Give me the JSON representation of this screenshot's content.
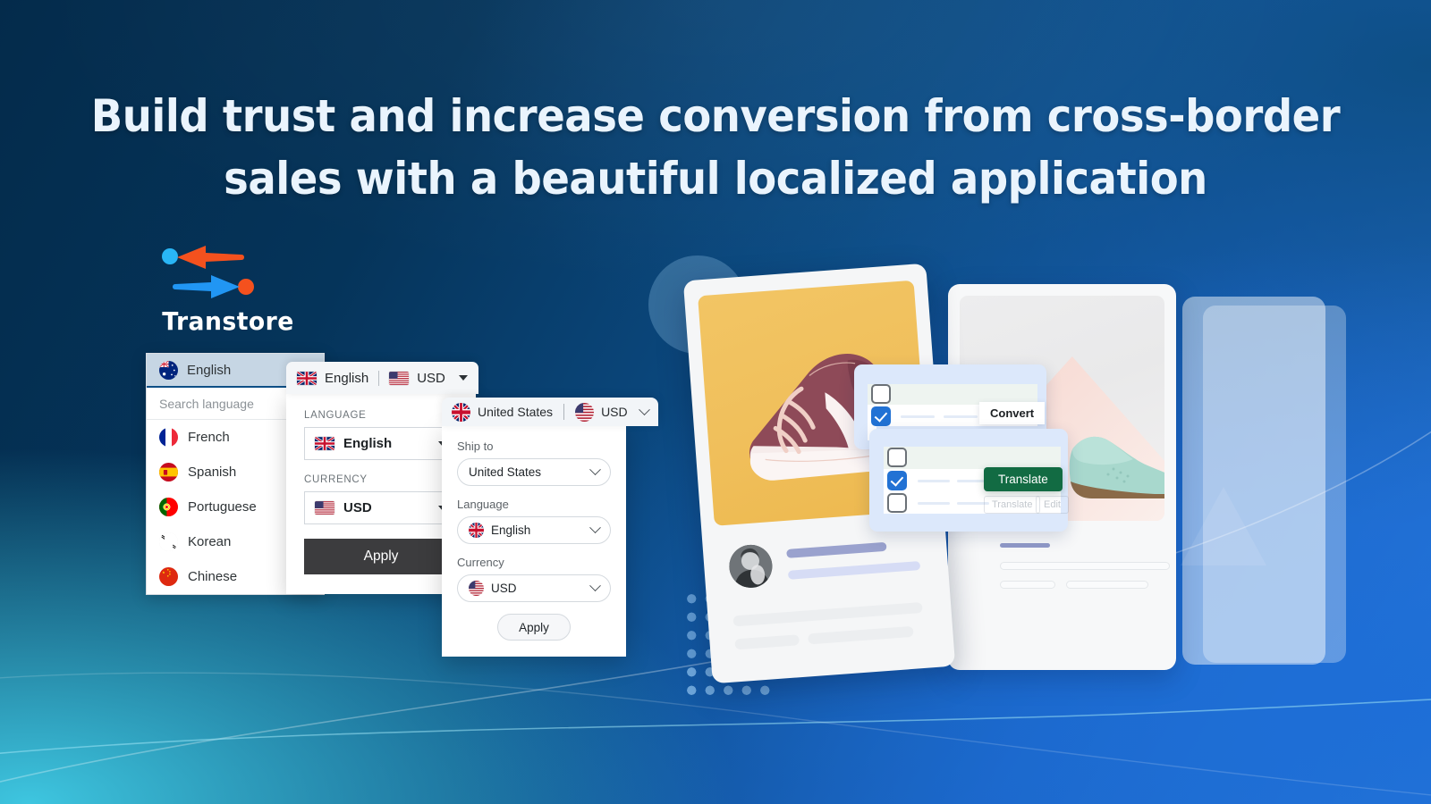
{
  "headline": "Build trust and increase conversion from cross-border\nsales with a beautiful localized application",
  "brand": {
    "name": "Transtore",
    "logo_arrow_left_color": "#f4511e",
    "logo_arrow_right_color": "#2196f3",
    "logo_dot_left_color": "#29b6f6",
    "logo_dot_right_color": "#f4511e"
  },
  "colors": {
    "bg_dark_navy": "#042b4b",
    "bg_royal_blue": "#1b63c8",
    "bg_cyan": "#3ec6e0",
    "accent_blue": "#2272d4",
    "translate_green": "#126b43",
    "apply_dark": "#3c3c3e"
  },
  "language_panel": {
    "selected": {
      "label": "English",
      "flag": "au-flag-icon"
    },
    "search_placeholder": "Search language",
    "items": [
      {
        "label": "French",
        "flag": "fr-flag-icon"
      },
      {
        "label": "Spanish",
        "flag": "es-flag-icon"
      },
      {
        "label": "Portuguese",
        "flag": "pt-flag-icon"
      },
      {
        "label": "Korean",
        "flag": "kr-flag-icon"
      },
      {
        "label": "Chinese",
        "flag": "cn-flag-icon"
      }
    ]
  },
  "lang_currency_panel": {
    "trigger": {
      "language": "English",
      "currency": "USD",
      "language_flag": "gb-flag-icon",
      "currency_flag": "us-flag-icon"
    },
    "language_label": "LANGUAGE",
    "language_value": "English",
    "currency_label": "CURRENCY",
    "currency_value": "USD",
    "apply_label": "Apply"
  },
  "ship_panel": {
    "trigger": {
      "country": "United States",
      "currency": "USD",
      "country_flag": "gb-flag-icon",
      "currency_flag": "us-flag-icon"
    },
    "ship_to_label": "Ship to",
    "ship_to_value": "United States",
    "language_label": "Language",
    "language_value": "English",
    "currency_label": "Currency",
    "currency_value": "USD",
    "apply_label": "Apply"
  },
  "mockup": {
    "convert_button": "Convert",
    "translate_button": "Translate",
    "ghost_translate": "Translate",
    "ghost_edit": "Edit",
    "left_card_image": "burgundy-sneaker-photo",
    "right_card_image": "mint-brogue-shoe-photo",
    "avatar_alt": "user-avatar-photo"
  }
}
